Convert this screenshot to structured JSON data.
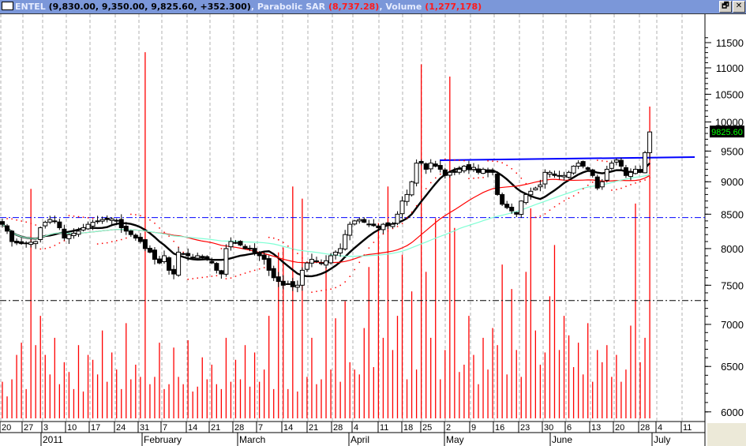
{
  "title": {
    "symbol": "ENTEL",
    "ohlc_text": "(9,830.00, 9,350.00, 9,825.60, +352.300)",
    "sar_label": "Parabolic SAR",
    "sar_value": "(8,737.28)",
    "volume_label": "Volume",
    "volume_value": "(1,277,178)",
    "sep1": ",",
    "sep2": ","
  },
  "window_buttons": {
    "restore": "🗗",
    "close": "✕"
  },
  "price_axis": {
    "ticks": [
      "11500",
      "11000",
      "10500",
      "10000",
      "9500",
      "9000",
      "8500",
      "8000",
      "7500",
      "7000",
      "6500",
      "6000"
    ],
    "last_price_label": "9825.60",
    "min": 6000,
    "max": 11500,
    "scale": "log"
  },
  "date_axis": {
    "day_labels": [
      "20",
      "27",
      "3",
      "10",
      "17",
      "24",
      "31",
      "7",
      "14",
      "21",
      "28",
      "7",
      "14",
      "21",
      "28",
      "4",
      "11",
      "18",
      "25",
      "2",
      "9",
      "16",
      "23",
      "30",
      "6",
      "13",
      "20",
      "28",
      "4",
      "11"
    ],
    "month_labels": [
      "2011",
      "February",
      "March",
      "April",
      "May",
      "June",
      "July"
    ]
  },
  "reference_lines": {
    "upper": 8450,
    "lower": 7300,
    "resistance": 9400
  },
  "colors": {
    "up": "#ffffff",
    "down": "#000000",
    "volume": "#ff0000",
    "ma_fast": "#000000",
    "ma_mid": "#ff0000",
    "ma_slow": "#7fffd4",
    "sar": "#ff0000",
    "guide": "#0000ff",
    "price_tag_bg": "#000000",
    "price_tag_fg": "#00ff00"
  },
  "chart_data": {
    "type": "candlestick",
    "closes": [
      8350,
      8250,
      8100,
      8080,
      8070,
      8080,
      8090,
      8100,
      8300,
      8380,
      8420,
      8400,
      8300,
      8150,
      8200,
      8220,
      8250,
      8300,
      8350,
      8380,
      8400,
      8420,
      8420,
      8430,
      8400,
      8300,
      8250,
      8200,
      8150,
      8100,
      8000,
      7950,
      7850,
      7800,
      7900,
      7700,
      7650,
      7950,
      7930,
      7900,
      7880,
      7900,
      7870,
      7850,
      7800,
      7700,
      7650,
      8000,
      8100,
      8080,
      8050,
      8000,
      8000,
      7950,
      7900,
      7850,
      7700,
      7600,
      7550,
      7500,
      7520,
      7480,
      7500,
      7700,
      7800,
      7850,
      7820,
      7800,
      7830,
      7900,
      7950,
      8000,
      8200,
      8350,
      8400,
      8420,
      8380,
      8350,
      8330,
      8300,
      8350,
      8330,
      8350,
      8500,
      8700,
      8800,
      9000,
      9300,
      9300,
      9200,
      9300,
      9250,
      9200,
      9100,
      9150,
      9150,
      9200,
      9250,
      9200,
      9230,
      9150,
      9200,
      9150,
      9150,
      8800,
      8650,
      8600,
      8550,
      8500,
      8700,
      8800,
      8850,
      8900,
      8950,
      9150,
      9150,
      9100,
      9100,
      9100,
      9150,
      9250,
      9300,
      9250,
      9200,
      9100,
      8900,
      9000,
      9200,
      9300,
      9350,
      9250,
      9100,
      9150,
      9200,
      9150,
      9473.3,
      9825.6
    ],
    "last_bar": {
      "open": 9473.3,
      "high": 9830,
      "low": 9350,
      "close": 9825.6
    },
    "volume_thousands": [
      150,
      90,
      160,
      260,
      310,
      120,
      940,
      300,
      420,
      260,
      180,
      330,
      140,
      230,
      190,
      120,
      300,
      110,
      260,
      240,
      180,
      360,
      150,
      270,
      200,
      120,
      390,
      160,
      220,
      170,
      1500,
      140,
      170,
      310,
      120,
      140,
      290,
      170,
      140,
      320,
      110,
      130,
      250,
      160,
      220,
      140,
      120,
      330,
      150,
      240,
      160,
      300,
      130,
      270,
      150,
      200,
      420,
      120,
      680,
      700,
      120,
      950,
      110,
      900,
      170,
      330,
      140,
      160,
      620,
      200,
      410,
      150,
      480,
      230,
      200,
      180,
      370,
      620,
      210,
      800,
      330,
      950,
      280,
      420,
      670,
      160,
      520,
      200,
      1450,
      600,
      330,
      820,
      160,
      280,
      1400,
      780,
      190,
      220,
      420,
      260,
      140,
      330,
      200,
      370,
      300,
      630,
      180,
      530,
      280,
      170,
      600,
      860,
      360,
      220,
      270,
      500,
      710,
      280,
      420,
      340,
      210,
      310,
      180,
      390,
      150,
      280,
      230,
      300,
      170,
      260,
      150,
      200,
      380,
      880,
      230,
      330,
      1277
    ],
    "series": [
      "MA fast (black)",
      "MA mid (red)",
      "MA slow (aqua)",
      "Parabolic SAR (red dots)",
      "Volume (red bars)"
    ]
  }
}
